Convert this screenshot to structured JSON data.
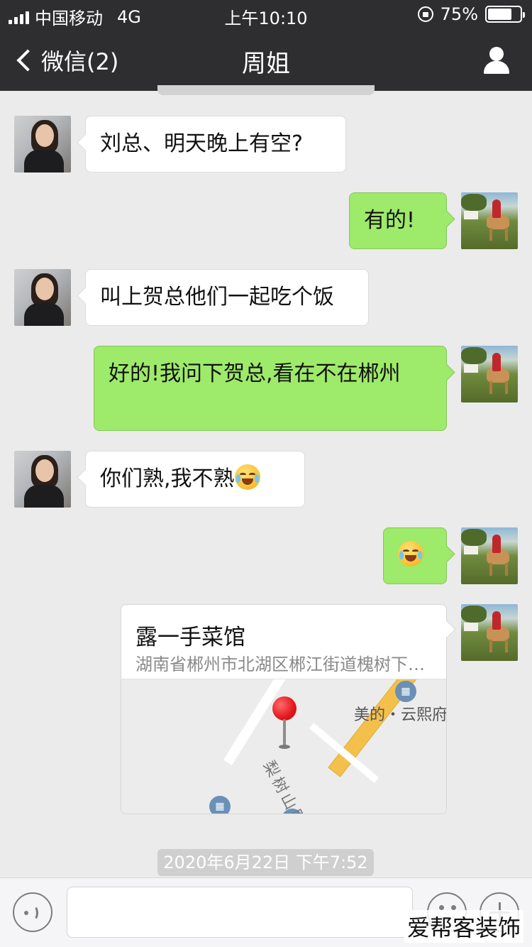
{
  "status_bar": {
    "carrier": "中国移动",
    "network": "4G",
    "time": "上午10:10",
    "battery_text": "75%",
    "battery_level": 0.75
  },
  "nav": {
    "back_label": "微信(2)",
    "title": "周姐"
  },
  "messages": [
    {
      "side": "in",
      "text": "刘总、明天晚上有空?"
    },
    {
      "side": "out",
      "text": "有的!"
    },
    {
      "side": "in",
      "text": "叫上贺总他们一起吃个饭"
    },
    {
      "side": "out",
      "text": "好的!我问下贺总,看在不在郴州"
    },
    {
      "side": "in",
      "text": "你们熟,我不熟",
      "emoji": "face-with-tears-of-joy-icon"
    },
    {
      "side": "out",
      "text": "",
      "emoji": "face-with-tears-of-joy-icon"
    }
  ],
  "location": {
    "name": "露一手菜馆",
    "address": "湖南省郴州市北湖区郴江街道槐树下…",
    "poi_label": "美的・云熙府",
    "street_label": "梨树山路"
  },
  "timestamp": "2020年6月22日 下午7:52",
  "watermark": "爱帮客装饰",
  "colors": {
    "header": "#2e2e30",
    "out_bubble": "#9eea6a",
    "in_bubble": "#ffffff",
    "background": "#ebebeb"
  }
}
